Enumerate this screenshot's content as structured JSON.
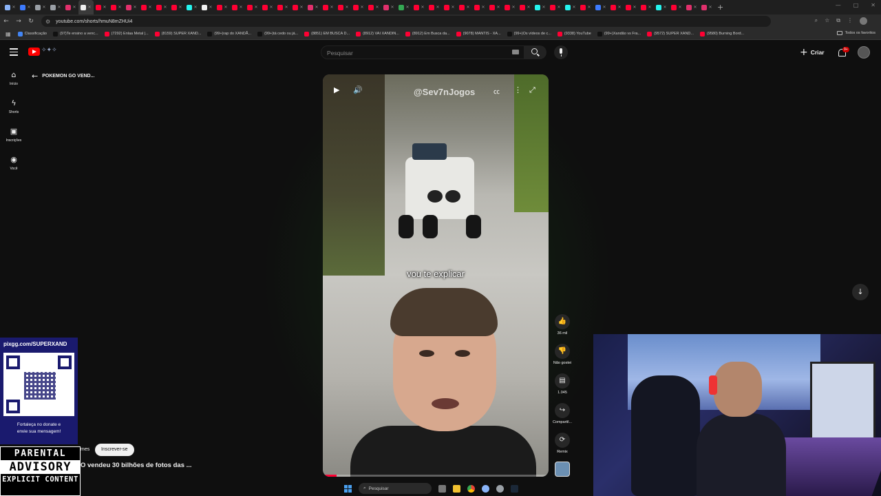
{
  "browser": {
    "url": "youtube.com/shorts/hmuN8mZHUi4",
    "tab_colors": [
      "#8ab4f8",
      "#3d7bff",
      "#9aa0a6",
      "#9aa0a6",
      "#e1306c",
      "#f1f1f1",
      "#ff0033",
      "#ff0033",
      "#e1306c",
      "#ff0033",
      "#ff0033",
      "#ff0033",
      "#25f4ee",
      "#f1f1f1",
      "#ff0033",
      "#ff0033",
      "#ff0033",
      "#ff0033",
      "#ff0033",
      "#ff0033",
      "#e1306c",
      "#ff0033",
      "#ff0033",
      "#ff0033",
      "#ff0033",
      "#e1306c",
      "#34a853",
      "#ff0033",
      "#ff0033",
      "#ff0033",
      "#ff0033",
      "#ff0033",
      "#ff0033",
      "#ff0033",
      "#ff0033",
      "#25f4ee",
      "#ff0033",
      "#25f4ee",
      "#ff0033",
      "#3d7bff",
      "#ff0033",
      "#ff0033",
      "#ff0033",
      "#25f4ee",
      "#ff0033",
      "#e1306c",
      "#e1306c"
    ],
    "bookmarks": [
      {
        "label": "Classificação",
        "color": "#4285f4"
      },
      {
        "label": "(97)Te ensino a venc...",
        "color": "#111"
      },
      {
        "label": "(7292) Enlaa Metal |...",
        "color": "#ff0033"
      },
      {
        "label": "(8159) SUPER XAND...",
        "color": "#ff0033"
      },
      {
        "label": "(99+)rap do XANDÃ...",
        "color": "#111"
      },
      {
        "label": "(99+)tá cedo ou já...",
        "color": "#111"
      },
      {
        "label": "(8851) EM BUSCA D...",
        "color": "#ff0033"
      },
      {
        "label": "(8912) VAI XANDIN...",
        "color": "#ff0033"
      },
      {
        "label": "(8912) Em Busca da...",
        "color": "#ff0033"
      },
      {
        "label": "(9078) MANTIS - XA...",
        "color": "#ff0033"
      },
      {
        "label": "(99+)Os vídeos de c...",
        "color": "#111"
      },
      {
        "label": "(9338) YouTube",
        "color": "#ff0033"
      },
      {
        "label": "(99+)Xandão vs Fra...",
        "color": "#111"
      },
      {
        "label": "(9572) SUPER XAND...",
        "color": "#ff0033"
      },
      {
        "label": "(9580) Burning Bord...",
        "color": "#ff0033"
      }
    ],
    "all_bookmarks": "Todos os favoritos"
  },
  "header": {
    "search_placeholder": "Pesquisar",
    "create_label": "Criar",
    "notif_badge": "9+"
  },
  "leftnav": [
    {
      "label": "Início",
      "icon": "home-icon",
      "glyph": "⌂"
    },
    {
      "label": "Shorts",
      "icon": "shorts-icon",
      "glyph": "ϟ"
    },
    {
      "label": "Inscrições",
      "icon": "subscriptions-icon",
      "glyph": "▣"
    },
    {
      "label": "Você",
      "icon": "you-icon",
      "glyph": "◉"
    }
  ],
  "short": {
    "back_title": "POKEMON GO VEND...",
    "watermark": "@Sev7nJogos",
    "caption": "vou te explicar",
    "progress": 0.06
  },
  "actions": [
    {
      "name": "like",
      "glyph": "👍",
      "label": "36 mil"
    },
    {
      "name": "dislike",
      "glyph": "👎",
      "label": "Não gostei"
    },
    {
      "name": "comments",
      "glyph": "▤",
      "label": "1.045"
    },
    {
      "name": "share",
      "glyph": "↪",
      "label": "Compartil..."
    },
    {
      "name": "remix",
      "glyph": "⟳",
      "label": "Remix"
    }
  ],
  "overlay": {
    "qr_url": "pixgg.com/SUPERXAND",
    "qr_message_1": "Fortaleça no donate e",
    "qr_message_2": "envie sua mensagem!",
    "pa_1": "PARENTAL",
    "pa_2": "ADVISORY",
    "pa_3": "EXPLICIT CONTENT"
  },
  "channel": {
    "name_fragment": "mes",
    "subscribe_label": "Inscrever-se",
    "video_title": "O vendeu 30 bilhões de fotos das ..."
  },
  "taskbar": {
    "search_label": "Pesquisar"
  }
}
